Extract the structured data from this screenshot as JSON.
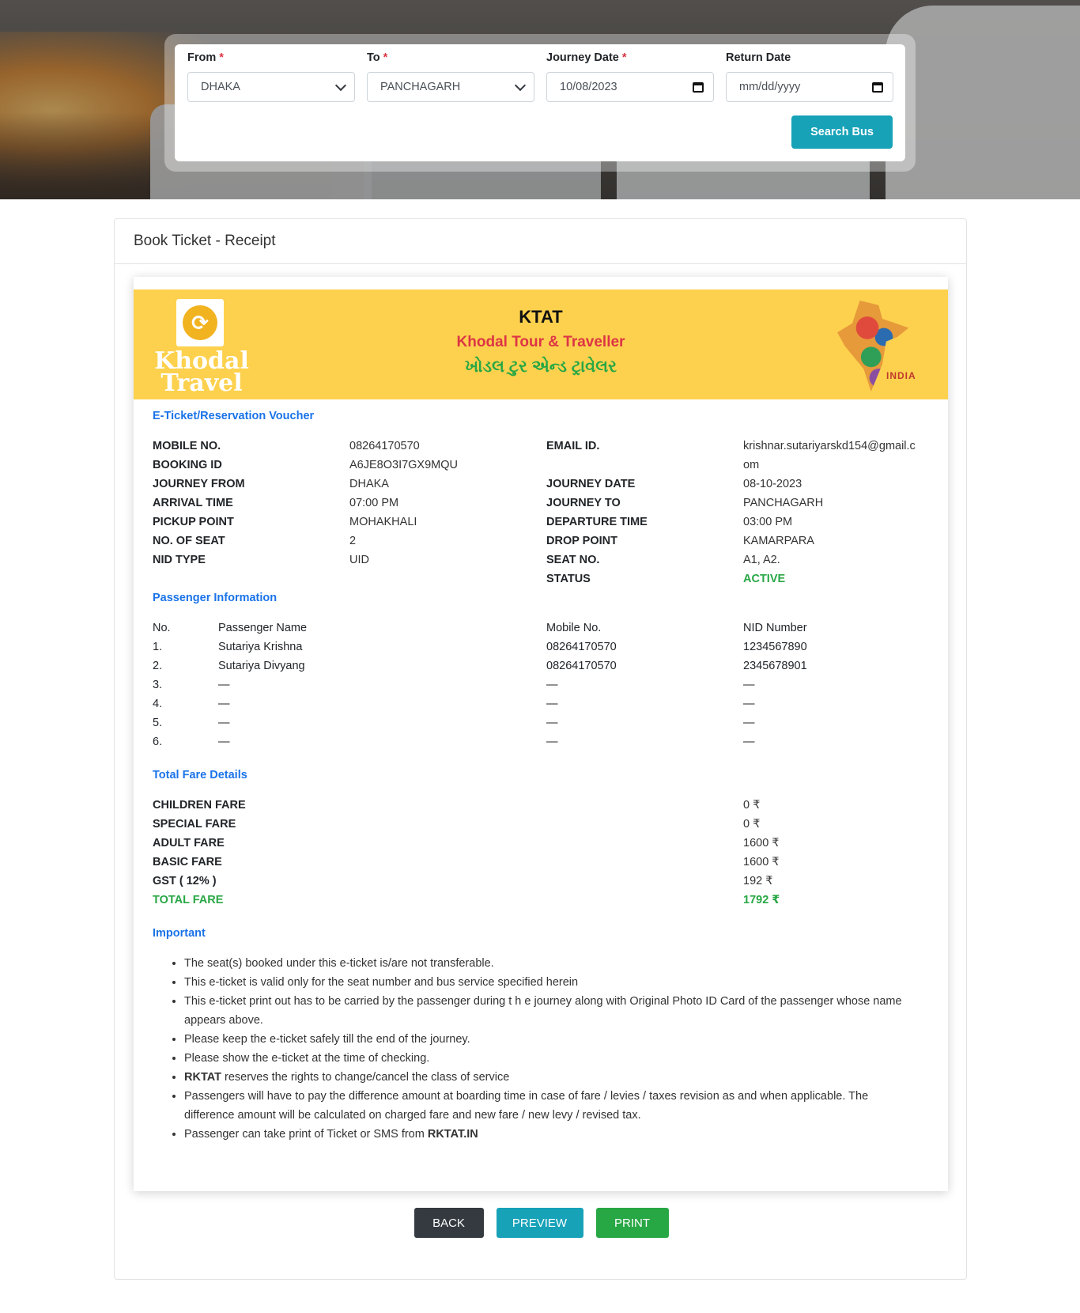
{
  "search": {
    "from_label": "From",
    "to_label": "To",
    "journey_date_label": "Journey Date",
    "return_date_label": "Return Date",
    "required_mark": "*",
    "from_value": "DHAKA",
    "to_value": "PANCHAGARH",
    "journey_date_value": "10/08/2023",
    "return_date_placeholder": "mm/dd/yyyy",
    "search_button": "Search Bus"
  },
  "card": {
    "title": "Book Ticket - Receipt"
  },
  "banner": {
    "logo_line1": "Khodal",
    "logo_line2": "Travel",
    "short_name": "KTAT",
    "full_name": "Khodal Tour & Traveller",
    "gujarati_name": "ખોડલ ટુર એન્ડ ટ્રાવેલર",
    "india_label": "INDIA"
  },
  "voucher": {
    "title": "E-Ticket/Reservation Voucher",
    "left": [
      {
        "k": "MOBILE NO.",
        "v": "08264170570"
      },
      {
        "k": "BOOKING ID",
        "v": "A6JE8O3I7GX9MQU"
      },
      {
        "k": "JOURNEY FROM",
        "v": "DHAKA"
      },
      {
        "k": "ARRIVAL TIME",
        "v": "07:00 PM"
      },
      {
        "k": "PICKUP POINT",
        "v": "MOHAKHALI"
      },
      {
        "k": "NO. OF SEAT",
        "v": "2"
      },
      {
        "k": "NID TYPE",
        "v": "UID"
      }
    ],
    "email_label": "EMAIL ID.",
    "email_value_1": "krishnar.sutariyarskd154@gmail.c",
    "email_value_2": "om",
    "right": [
      {
        "k": "JOURNEY DATE",
        "v": "08-10-2023"
      },
      {
        "k": "JOURNEY TO",
        "v": "PANCHAGARH"
      },
      {
        "k": "DEPARTURE TIME",
        "v": "03:00 PM"
      },
      {
        "k": "DROP POINT",
        "v": "KAMARPARA"
      },
      {
        "k": "SEAT NO.",
        "v": "A1, A2."
      },
      {
        "k": "STATUS",
        "v": "ACTIVE"
      }
    ]
  },
  "passengers": {
    "title": "Passenger Information",
    "headers": {
      "no": "No.",
      "name": "Passenger Name",
      "mobile": "Mobile No.",
      "nid": "NID Number"
    },
    "rows": [
      {
        "no": "1.",
        "name": "Sutariya Krishna",
        "mobile": "08264170570",
        "nid": "1234567890"
      },
      {
        "no": "2.",
        "name": "Sutariya Divyang",
        "mobile": "08264170570",
        "nid": "2345678901"
      },
      {
        "no": "3.",
        "name": "—",
        "mobile": "—",
        "nid": "—"
      },
      {
        "no": "4.",
        "name": "—",
        "mobile": "—",
        "nid": "—"
      },
      {
        "no": "5.",
        "name": "—",
        "mobile": "—",
        "nid": "—"
      },
      {
        "no": "6.",
        "name": "—",
        "mobile": "—",
        "nid": "—"
      }
    ]
  },
  "fare": {
    "title": "Total Fare Details",
    "rows": [
      {
        "k": "CHILDREN FARE",
        "v": "0 ₹"
      },
      {
        "k": "SPECIAL FARE",
        "v": "0 ₹"
      },
      {
        "k": "ADULT FARE",
        "v": "1600 ₹"
      },
      {
        "k": "BASIC FARE",
        "v": "1600 ₹"
      },
      {
        "k": "GST ( 12% )",
        "v": "192 ₹"
      },
      {
        "k": "TOTAL FARE",
        "v": "1792 ₹"
      }
    ]
  },
  "important": {
    "title": "Important",
    "items": [
      "The seat(s) booked under this e-ticket is/are not transferable.",
      "This e-ticket is valid only for the seat number and bus service specified herein",
      "This e-ticket print out has to be carried by the passenger during t h e journey along with Original Photo ID Card of the passenger whose name appears above.",
      "Please keep the e-ticket safely till the end of the journey.",
      "Please show the e-ticket at the time of checking."
    ],
    "item6_bold": "RKTAT",
    "item6_rest": " reserves the rights to change/cancel the class of service",
    "item7": "Passengers will have to pay the difference amount at boarding time in case of fare / levies / taxes revision as and when applicable. The difference amount will be calculated on charged fare and new fare / new levy / revised tax.",
    "item8_rest": "Passenger can take print of Ticket or SMS from ",
    "item8_bold": "RKTAT.IN"
  },
  "buttons": {
    "back": "BACK",
    "preview": "PREVIEW",
    "print": "PRINT"
  },
  "colors": {
    "accent": "#17a2b8",
    "banner": "#fdd14e",
    "section_title": "#1a73e8",
    "success": "#28a745",
    "danger": "#dc3545"
  }
}
